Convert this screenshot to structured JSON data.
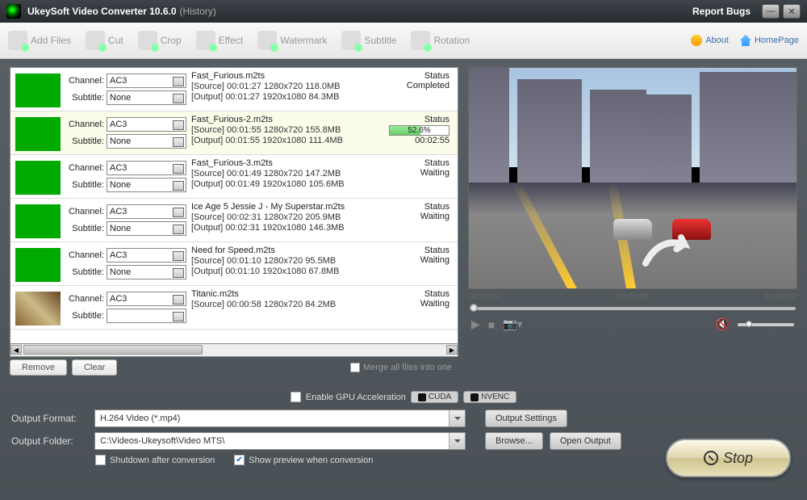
{
  "title": {
    "app": "UkeySoft Video Converter 10.6.0",
    "history": "(History)",
    "report": "Report Bugs"
  },
  "toolbar": {
    "add": "Add Files",
    "cut": "Cut",
    "crop": "Crop",
    "effect": "Effect",
    "watermark": "Watermark",
    "subtitle": "Subtitle",
    "rotation": "Rotation",
    "about": "About",
    "home": "HomePage"
  },
  "labels": {
    "channel": "Channel:",
    "subtitle": "Subtitle:",
    "status": "Status"
  },
  "items": [
    {
      "channel": "AC3",
      "subtitle": "None",
      "name": "Fast_Furious.m2ts",
      "src": "[Source]  00:01:27  1280x720  118.0MB",
      "out": "[Output]  00:01:27  1920x1080  84.3MB",
      "status": "Completed",
      "progress": null,
      "eta": null,
      "thumb": "green"
    },
    {
      "channel": "AC3",
      "subtitle": "None",
      "name": "Fast_Furious-2.m2ts",
      "src": "[Source]  00:01:55  1280x720  155.8MB",
      "out": "[Output]  00:01:55  1920x1080  111.4MB",
      "status": null,
      "progress": "52.6%",
      "progressPct": 52.6,
      "eta": "00:02:55",
      "thumb": "green",
      "sel": true
    },
    {
      "channel": "AC3",
      "subtitle": "None",
      "name": "Fast_Furious-3.m2ts",
      "src": "[Source]  00:01:49  1280x720  147.2MB",
      "out": "[Output]  00:01:49  1920x1080  105.6MB",
      "status": "Waiting",
      "progress": null,
      "eta": null,
      "thumb": "green"
    },
    {
      "channel": "AC3",
      "subtitle": "None",
      "name": "Ice Age 5  Jessie J  - My Superstar.m2ts",
      "src": "[Source]  00:02:31  1280x720  205.9MB",
      "out": "[Output]  00:02:31  1920x1080  146.3MB",
      "status": "Waiting",
      "progress": null,
      "eta": null,
      "thumb": "green"
    },
    {
      "channel": "AC3",
      "subtitle": "None",
      "name": "Need for Speed.m2ts",
      "src": "[Source]  00:01:10  1280x720  95.5MB",
      "out": "[Output]  00:01:10  1920x1080  67.8MB",
      "status": "Waiting",
      "progress": null,
      "eta": null,
      "thumb": "green"
    },
    {
      "channel": "AC3",
      "subtitle": "",
      "name": "Titanic.m2ts",
      "src": "[Source]  00:00:58  1280x720  84.2MB",
      "out": "",
      "status": "Waiting",
      "progress": null,
      "eta": null,
      "thumb": "img"
    }
  ],
  "listActions": {
    "remove": "Remove",
    "clear": "Clear",
    "merge": "Merge all files into one"
  },
  "preview": {
    "t1": "00:00:00",
    "t2": "00:00:00",
    "t3": "00:00:00"
  },
  "gpu": {
    "enable": "Enable GPU Acceleration",
    "cuda": "CUDA",
    "nvenc": "NVENC"
  },
  "output": {
    "formatLabel": "Output Format:",
    "format": "H.264 Video (*.mp4)",
    "folderLabel": "Output Folder:",
    "folder": "C:\\Videos-Ukeysoft\\Video MTS\\",
    "settings": "Output Settings",
    "browse": "Browse...",
    "open": "Open Output",
    "shutdown": "Shutdown after conversion",
    "showpreview": "Show preview when conversion"
  },
  "stop": "Stop"
}
